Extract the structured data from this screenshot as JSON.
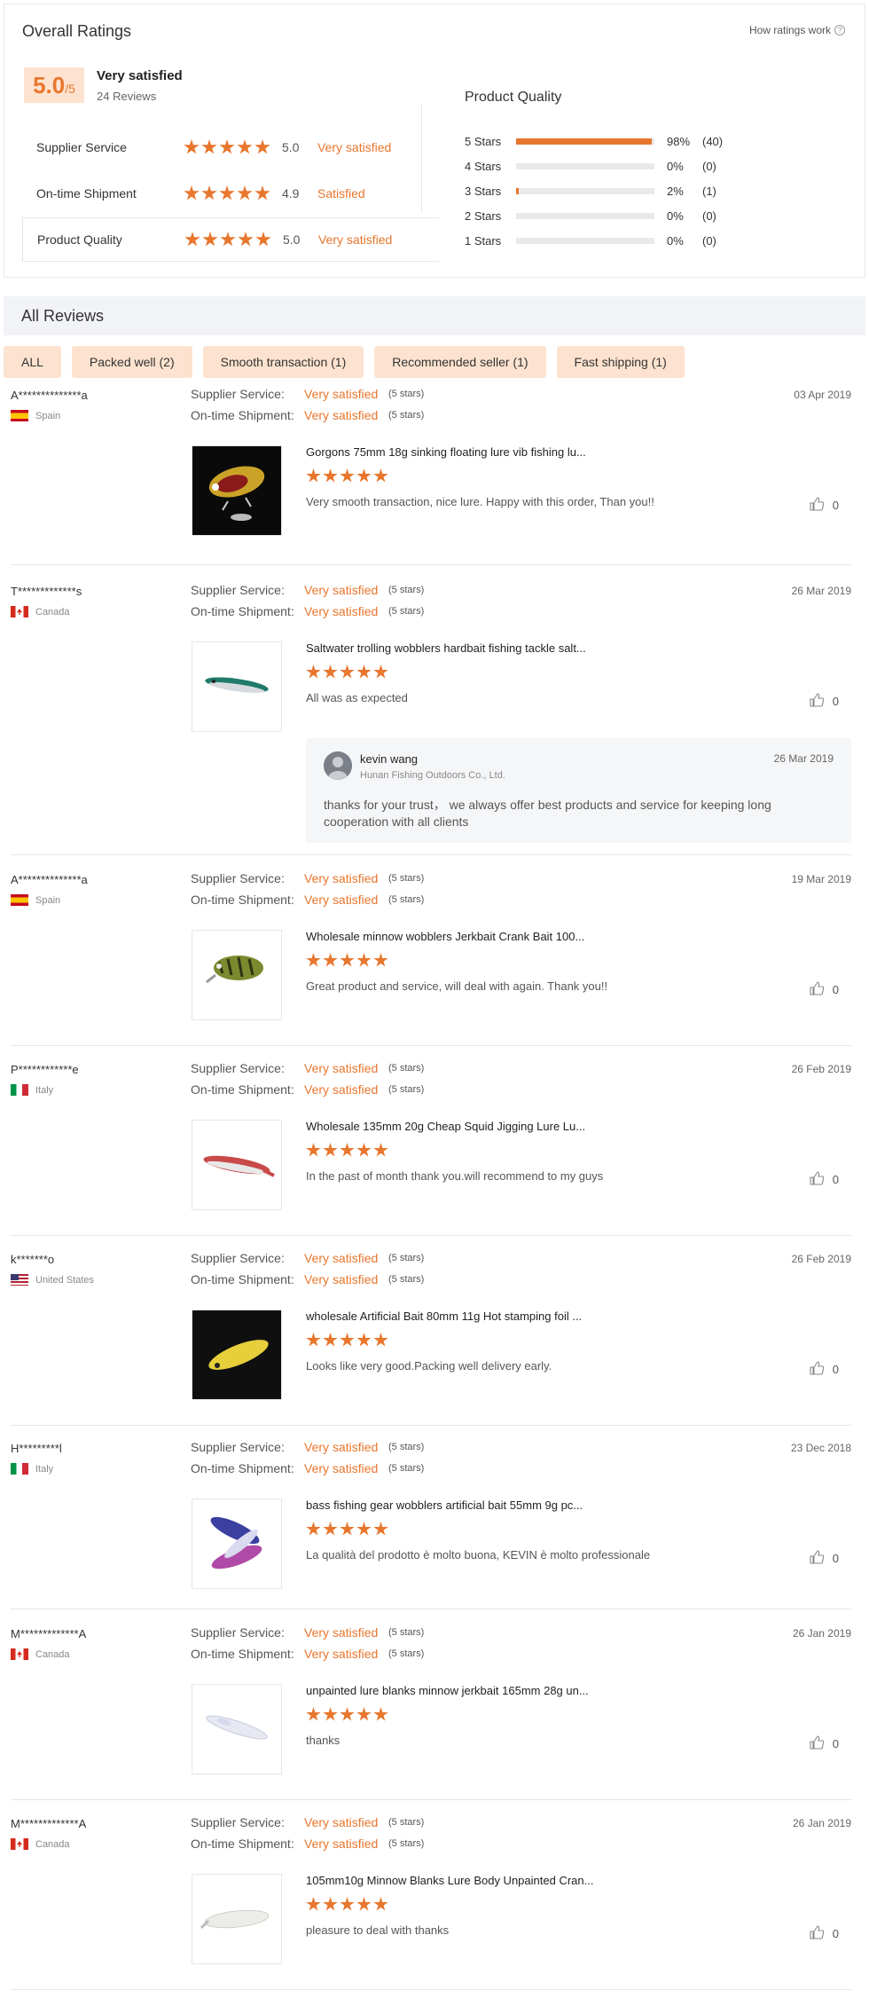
{
  "overall": {
    "title": "Overall Ratings",
    "how_ratings_work": "How ratings work",
    "score": "5.0",
    "score_max": "/5",
    "satisfaction": "Very satisfied",
    "review_count": "24 Reviews",
    "rows": [
      {
        "label": "Supplier Service",
        "value": "5.0",
        "text": "Very satisfied",
        "stars": 5
      },
      {
        "label": "On-time Shipment",
        "value": "4.9",
        "text": "Satisfied",
        "stars": 5
      },
      {
        "label": "Product Quality",
        "value": "5.0",
        "text": "Very satisfied",
        "stars": 5
      }
    ]
  },
  "product_quality": {
    "title": "Product Quality",
    "distribution": [
      {
        "label": "5 Stars",
        "pct": "98%",
        "count": "(40)",
        "fill": 0.98
      },
      {
        "label": "4 Stars",
        "pct": "0%",
        "count": "(0)",
        "fill": 0
      },
      {
        "label": "3 Stars",
        "pct": "2%",
        "count": "(1)",
        "fill": 0.02
      },
      {
        "label": "2 Stars",
        "pct": "0%",
        "count": "(0)",
        "fill": 0
      },
      {
        "label": "1 Stars",
        "pct": "0%",
        "count": "(0)",
        "fill": 0
      }
    ]
  },
  "all_reviews": {
    "title": "All Reviews",
    "filters": [
      "ALL",
      "Packed well (2)",
      "Smooth transaction (1)",
      "Recommended seller (1)",
      "Fast shipping (1)"
    ]
  },
  "labels": {
    "supplier_service": "Supplier Service:",
    "on_time_shipment": "On-time Shipment:",
    "stars_note": "(5 stars)"
  },
  "reviews": [
    {
      "user": "A**************a",
      "country": "Spain",
      "flag": "es",
      "date": "03 Apr 2019",
      "supplier": "Very satisfied",
      "shipment": "Very satisfied",
      "product": "Gorgons 75mm 18g sinking floating lure vib fishing lu...",
      "comment": "Very smooth transaction, nice lure. Happy with this order, Than you!!",
      "likes": "0"
    },
    {
      "user": "T*************s",
      "country": "Canada",
      "flag": "ca",
      "date": "26 Mar 2019",
      "supplier": "Very satisfied",
      "shipment": "Very satisfied",
      "product": "Saltwater trolling wobblers hardbait fishing tackle salt...",
      "comment": "All was as expected",
      "likes": "0",
      "reply": {
        "name": "kevin wang",
        "company": "Hunan Fishing Outdoors Co., Ltd.",
        "date": "26 Mar 2019",
        "text": "thanks for your trust， we always offer best products and service for keeping long cooperation with all clients"
      }
    },
    {
      "user": "A**************a",
      "country": "Spain",
      "flag": "es",
      "date": "19 Mar 2019",
      "supplier": "Very satisfied",
      "shipment": "Very satisfied",
      "product": "Wholesale minnow wobblers Jerkbait Crank Bait 100...",
      "comment": "Great product and service, will deal with again. Thank you!!",
      "likes": "0"
    },
    {
      "user": "P************e",
      "country": "Italy",
      "flag": "it",
      "date": "26 Feb 2019",
      "supplier": "Very satisfied",
      "shipment": "Very satisfied",
      "product": "Wholesale 135mm 20g Cheap Squid Jigging Lure Lu...",
      "comment": "In the past of month thank you.will recommend to my guys",
      "likes": "0"
    },
    {
      "user": "k*******o",
      "country": "United States",
      "flag": "us",
      "date": "26 Feb 2019",
      "supplier": "Very satisfied",
      "shipment": "Very satisfied",
      "product": "wholesale Artificial Bait 80mm 11g Hot stamping foil ...",
      "comment": "Looks like very good.Packing well delivery early.",
      "likes": "0"
    },
    {
      "user": "H*********l",
      "country": "Italy",
      "flag": "it",
      "date": "23 Dec 2018",
      "supplier": "Very satisfied",
      "shipment": "Very satisfied",
      "product": "bass fishing gear wobblers artificial bait 55mm 9g pc...",
      "comment": "La qualità del prodotto è molto buona, KEVIN è molto professionale",
      "likes": "0"
    },
    {
      "user": "M*************A",
      "country": "Canada",
      "flag": "ca",
      "date": "26 Jan 2019",
      "supplier": "Very satisfied",
      "shipment": "Very satisfied",
      "product": "unpainted lure blanks minnow jerkbait 165mm 28g un...",
      "comment": "thanks",
      "likes": "0"
    },
    {
      "user": "M*************A",
      "country": "Canada",
      "flag": "ca",
      "date": "26 Jan 2019",
      "supplier": "Very satisfied",
      "shipment": "Very satisfied",
      "product": "105mm10g Minnow Blanks Lure Body Unpainted Cran...",
      "comment": "pleasure to deal with thanks",
      "likes": "0"
    }
  ],
  "colors": {
    "accent": "#e8762d",
    "chip_bg": "#fde3cf",
    "bar_bg": "#f2f3f7"
  },
  "icons": {
    "like": "thumbs-up-icon",
    "help": "question-circle-icon",
    "star": "star-icon"
  }
}
